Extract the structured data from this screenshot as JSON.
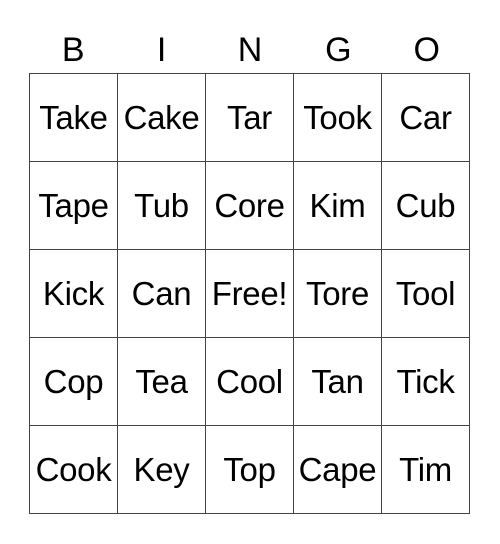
{
  "header": [
    "B",
    "I",
    "N",
    "G",
    "O"
  ],
  "cells": [
    [
      "Take",
      "Cake",
      "Tar",
      "Took",
      "Car"
    ],
    [
      "Tape",
      "Tub",
      "Core",
      "Kim",
      "Cub"
    ],
    [
      "Kick",
      "Can",
      "Free!",
      "Tore",
      "Tool"
    ],
    [
      "Cop",
      "Tea",
      "Cool",
      "Tan",
      "Tick"
    ],
    [
      "Cook",
      "Key",
      "Top",
      "Cape",
      "Tim"
    ]
  ]
}
